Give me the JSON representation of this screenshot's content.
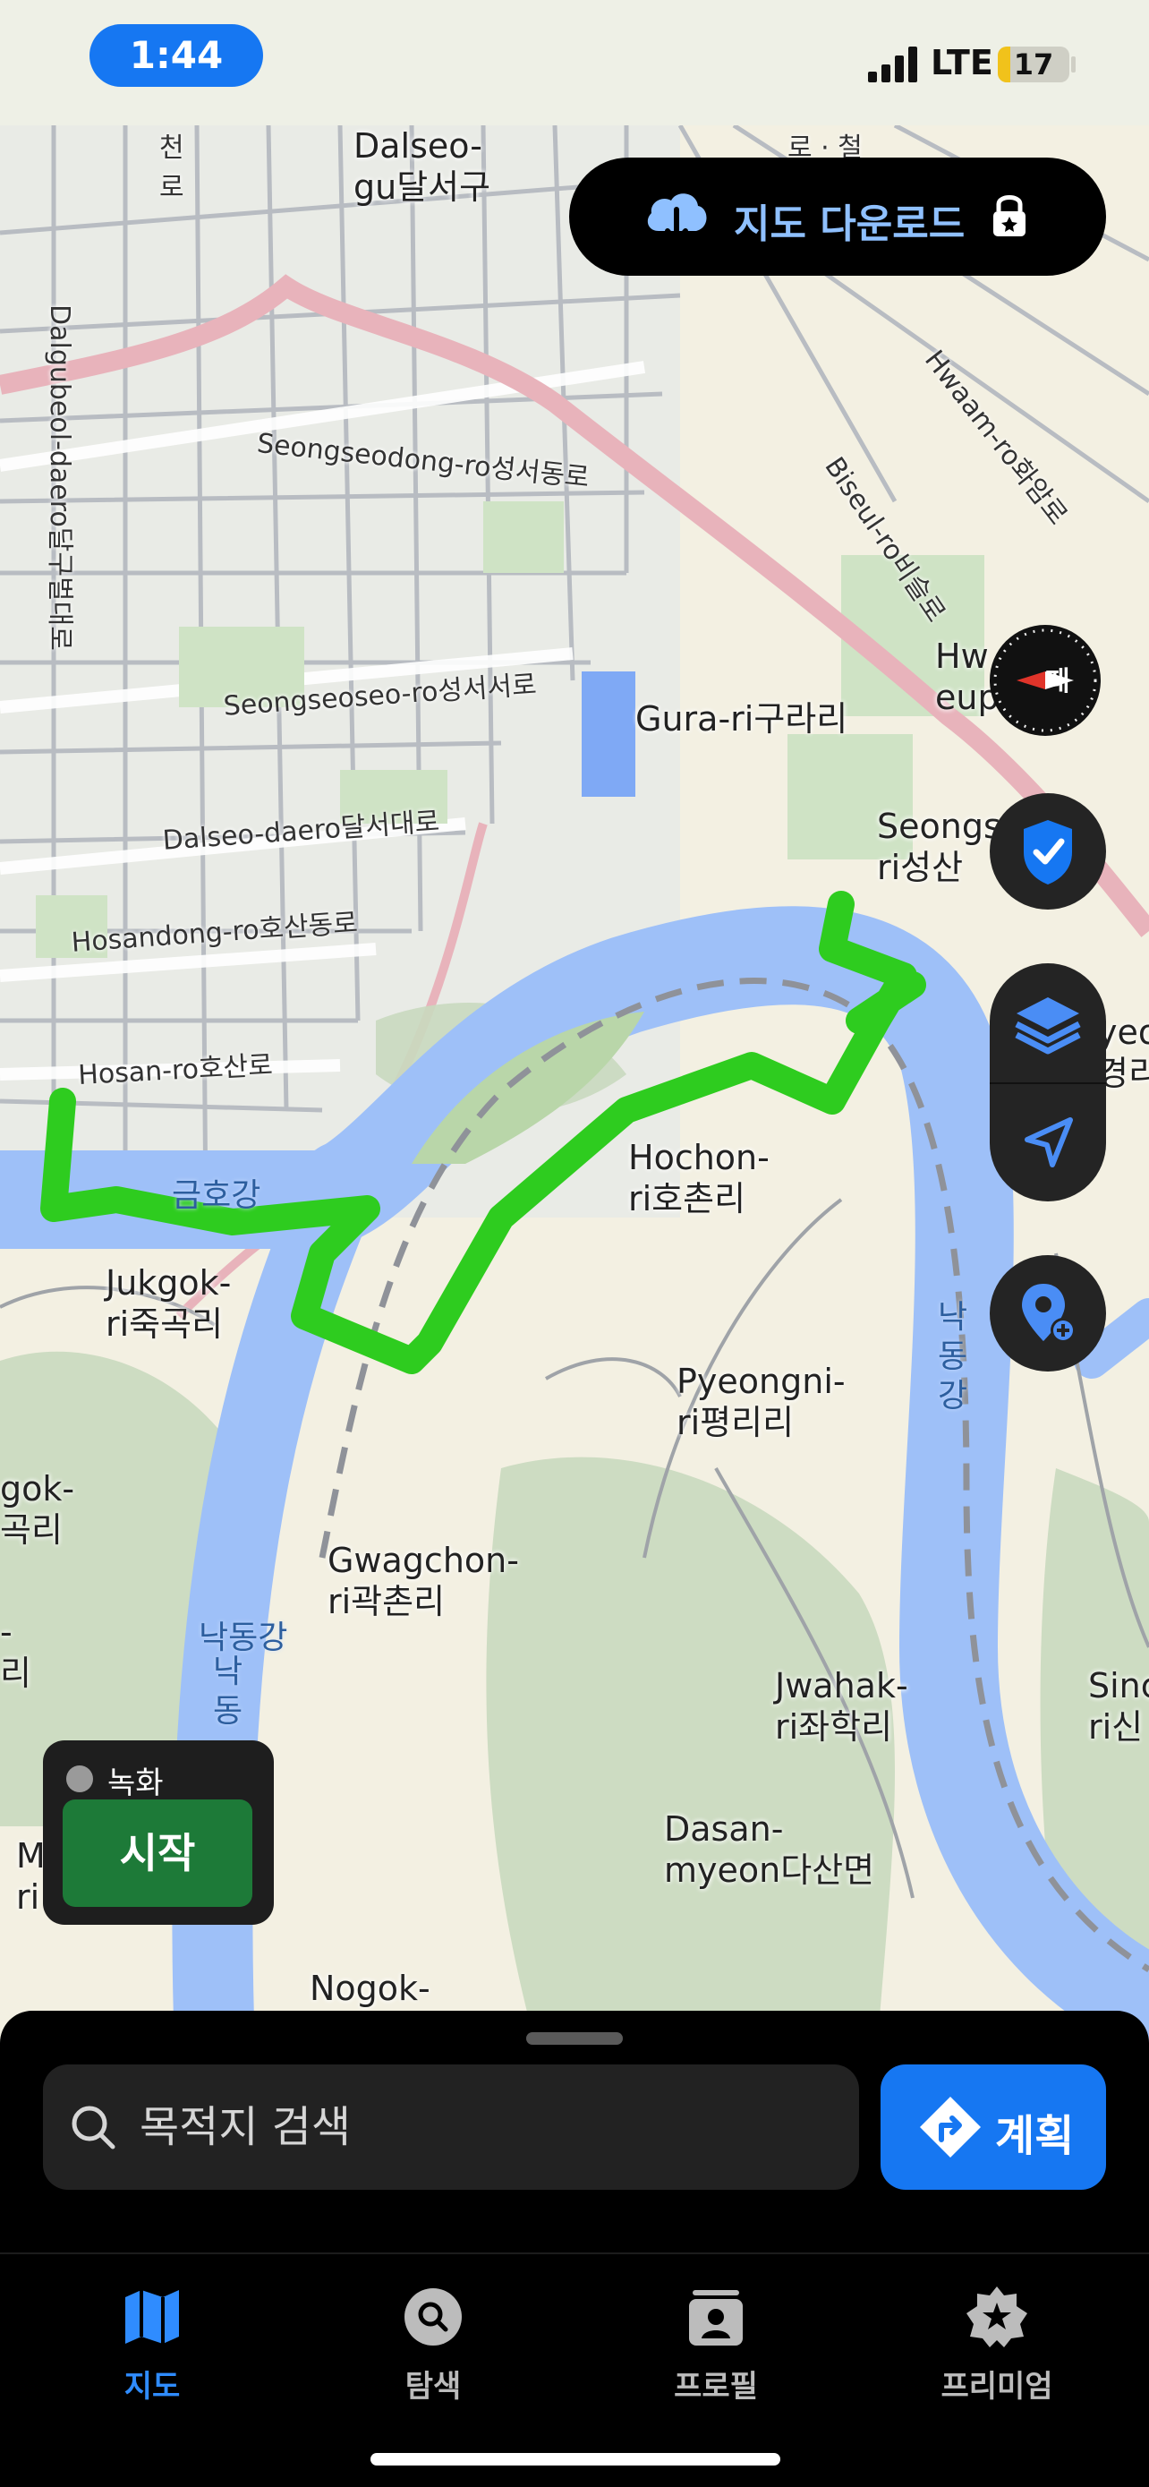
{
  "status_bar": {
    "time": "1:44",
    "network": "LTE",
    "battery": "17",
    "battery_level": 0.17
  },
  "colors": {
    "accent": "#1677f2",
    "route": "#2ecc1f",
    "river": "#9ec0f8",
    "sheet": "#000000",
    "start": "#1d7a38"
  },
  "download_button": {
    "label": "지도 다운로드",
    "icon": "cloud-download-icon",
    "lock_icon": "lock-star-icon"
  },
  "map": {
    "labels": {
      "dalseo_gu": "Dalseo-\ngu달서구",
      "gura_ri": "Gura-ri구라리",
      "hwa_eup": "Hw\neup",
      "seongsan_ri": "Seongs\nri성산",
      "hochon_ri": "Hochon-\nri호촌리",
      "jukgok_ri": "Jukgok-\nri죽곡리",
      "pyeongni_ri": "Pyeongni-\nri평리리",
      "gwagchon_ri": "Gwagchon-\nri곽촌리",
      "jwahak_ri": "Jwahak-\nri좌학리",
      "dasan_myeon": "Dasan-\nmyeon다산면",
      "nogok": "Nogok-",
      "gok_left": "gok-\n곡리",
      "sin_right": "Sinc\nri신",
      "m_left": "M\nri",
      "yeo_right": "yeo\n경리",
      "k_left": "-\n리"
    },
    "roads": {
      "seongseodong": "Seongseodong-ro성서동로",
      "seongseoseo": "Seongseoseo-ro성서서로",
      "dalseo_daero": "Dalseo-daero달서대로",
      "hosandong": "Hosandong-ro호산동로",
      "hosan": "Hosan-ro호산로",
      "dalgubeol": "Dalgubeol-daero달구벌대로",
      "biseul": "Biseul-ro비슬로",
      "hwaam": "Hwaam-ro화암로",
      "road_top": "로 · 철",
      "cheon_ro": "천\n로"
    },
    "water": {
      "geumho": "금호강",
      "nakdong_right": "낙\n동\n강",
      "nakdong_left": "낙동강",
      "nakdong_left_v": "낙\n동"
    }
  },
  "controls": {
    "compass": "compass-icon",
    "compass_text": "패",
    "shield": "shield-check-icon",
    "layers": "layers-icon",
    "locate": "location-arrow-icon",
    "add_pin": "add-pin-icon"
  },
  "record": {
    "label": "녹화",
    "start": "시작"
  },
  "search": {
    "placeholder": "목적지 검색"
  },
  "plan_button": {
    "label": "계획"
  },
  "tabs": [
    {
      "label": "지도",
      "icon": "map-icon",
      "active": true
    },
    {
      "label": "탐색",
      "icon": "search-icon",
      "active": false
    },
    {
      "label": "프로필",
      "icon": "profile-icon",
      "active": false
    },
    {
      "label": "프리미엄",
      "icon": "premium-star-icon",
      "active": false
    }
  ]
}
